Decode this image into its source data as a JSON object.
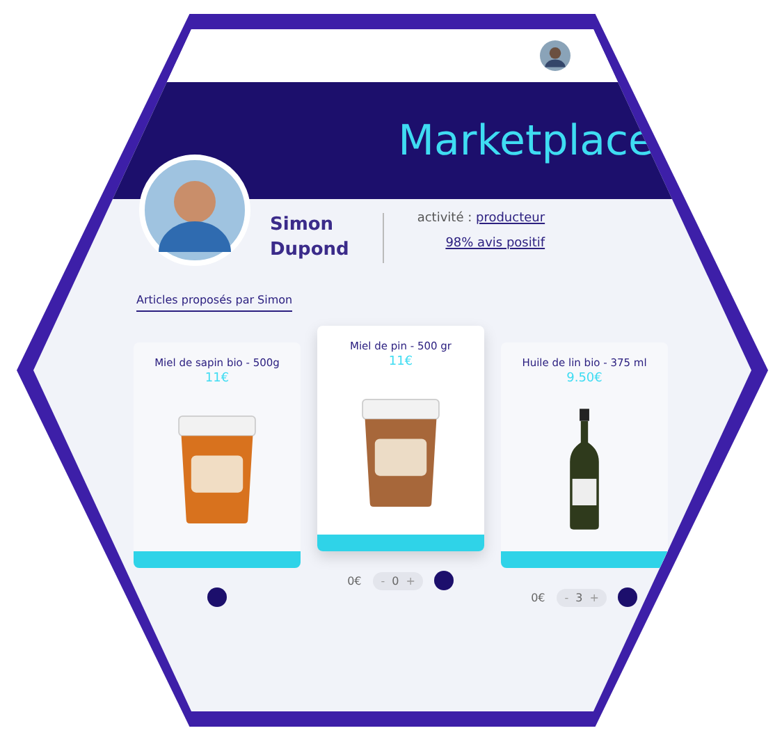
{
  "header": {
    "title": "Marketplace"
  },
  "seller": {
    "first_name": "Simon",
    "last_name": "Dupond",
    "activity_label": "activité :",
    "activity": "producteur",
    "rating": "98% avis positif"
  },
  "section_title": "Articles proposés par Simon",
  "products": [
    {
      "kind": "honey",
      "name": "Miel de sapin bio - 500g",
      "price": "11€",
      "color": "#d8721e",
      "selected": false
    },
    {
      "kind": "honey",
      "name": "Miel de pin - 500 gr",
      "price": "11€",
      "color": "#a7673a",
      "selected": true,
      "total": "0€",
      "decrease": "-",
      "quantity": "0",
      "increase": "+"
    },
    {
      "kind": "oil",
      "name": "Huile de lin bio - 375 ml",
      "price": "9.50€",
      "color": "#2f3a1c",
      "selected": false,
      "total": "0€",
      "decrease": "-",
      "quantity": "3",
      "increase": "+"
    }
  ]
}
